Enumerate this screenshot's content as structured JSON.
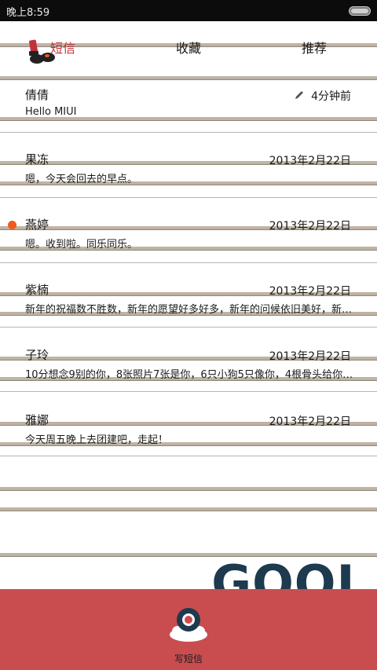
{
  "status_bar": {
    "time": "晚上8:59"
  },
  "tabs": [
    {
      "label": "短信",
      "active": true
    },
    {
      "label": "收藏",
      "active": false
    },
    {
      "label": "推荐",
      "active": false
    }
  ],
  "conversations": [
    {
      "name": "倩倩",
      "date": "4分钟前",
      "snippet": "Hello MIUI",
      "unread": false,
      "draft": true
    },
    {
      "name": "果冻",
      "date": "2013年2月22日",
      "snippet": "嗯，今天会回去的早点。",
      "unread": false
    },
    {
      "name": "燕婷",
      "date": "2013年2月22日",
      "snippet": "嗯。收到啦。同乐同乐。",
      "unread": true
    },
    {
      "name": "紫楠",
      "date": "2013年2月22日",
      "snippet": "新年的祝福数不胜数，新年的愿望好多好多，新年的问候依旧美好，新年的……",
      "unread": false
    },
    {
      "name": "子玲",
      "date": "2013年2月22日",
      "snippet": "10分想念9别的你，8张照片7张是你，6只小狗5只像你，4根骨头给你……",
      "unread": false
    },
    {
      "name": "雅娜",
      "date": "2013年2月22日",
      "snippet": "今天周五晚上去团建吧，走起！",
      "unread": false
    }
  ],
  "watermark": "GOOL",
  "bottom_bar": {
    "compose_label": "写短信"
  },
  "colors": {
    "accent": "#c0323a",
    "bottom_bar": "#c94d4f",
    "unread_dot": "#f05a1e",
    "watermark": "#1d3a4e"
  },
  "icons": {
    "tab_msgs": "lipstick-icon",
    "draft": "pencil-icon",
    "compose": "compose-icon"
  }
}
